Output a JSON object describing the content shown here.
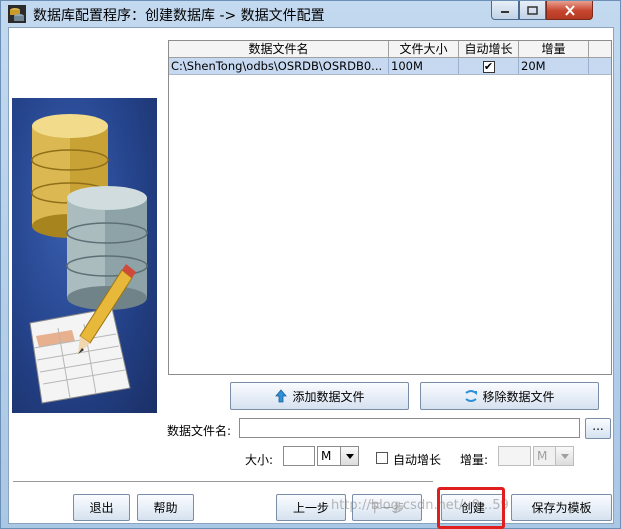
{
  "window": {
    "title": "数据库配置程序：创建数据库 -> 数据文件配置"
  },
  "table": {
    "headers": [
      "数据文件名",
      "文件大小",
      "自动增长",
      "增量"
    ],
    "rows": [
      {
        "filename": "C:\\ShenTong\\odbs\\OSRDB\\OSRDB0...",
        "size": "100M",
        "autogrow": "✔",
        "increment": "20M"
      }
    ]
  },
  "file_actions": {
    "add_label": "添加数据文件",
    "remove_label": "移除数据文件"
  },
  "form": {
    "filename_label": "数据文件名:",
    "filename_value": "",
    "browse_label": "...",
    "size_label": "大小:",
    "size_value": "",
    "size_unit": "M",
    "autogrow_label": "自动增长",
    "increment_label": "增量:",
    "increment_value": "",
    "increment_unit": "M"
  },
  "footer": {
    "exit_label": "退出",
    "help_label": "帮助",
    "prev_label": "上一步",
    "next_label": "下一步",
    "create_label": "创建",
    "save_template_label": "保存为模板"
  },
  "watermark": "http://blog.csdn.net/u0...59",
  "colors": {
    "highlight": "#e01e1e",
    "selected_row": "#c6d9f1",
    "title_gradient": "#aac7e6"
  }
}
